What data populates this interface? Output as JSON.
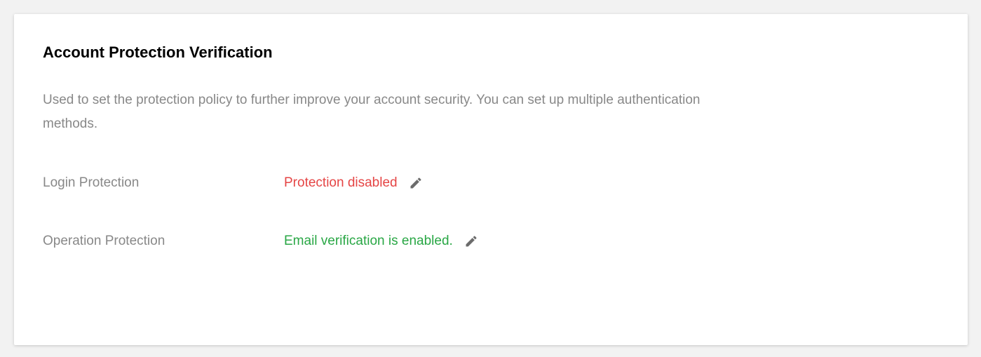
{
  "card": {
    "title": "Account Protection Verification",
    "description": "Used to set the protection policy to further improve your account security. You can set up multiple authentication methods."
  },
  "rows": [
    {
      "label": "Login Protection",
      "value": "Protection disabled",
      "status_color": "#e54545",
      "edit_icon": "pencil-icon"
    },
    {
      "label": "Operation Protection",
      "value": "Email verification is enabled.",
      "status_color": "#29a745",
      "edit_icon": "pencil-icon"
    }
  ]
}
